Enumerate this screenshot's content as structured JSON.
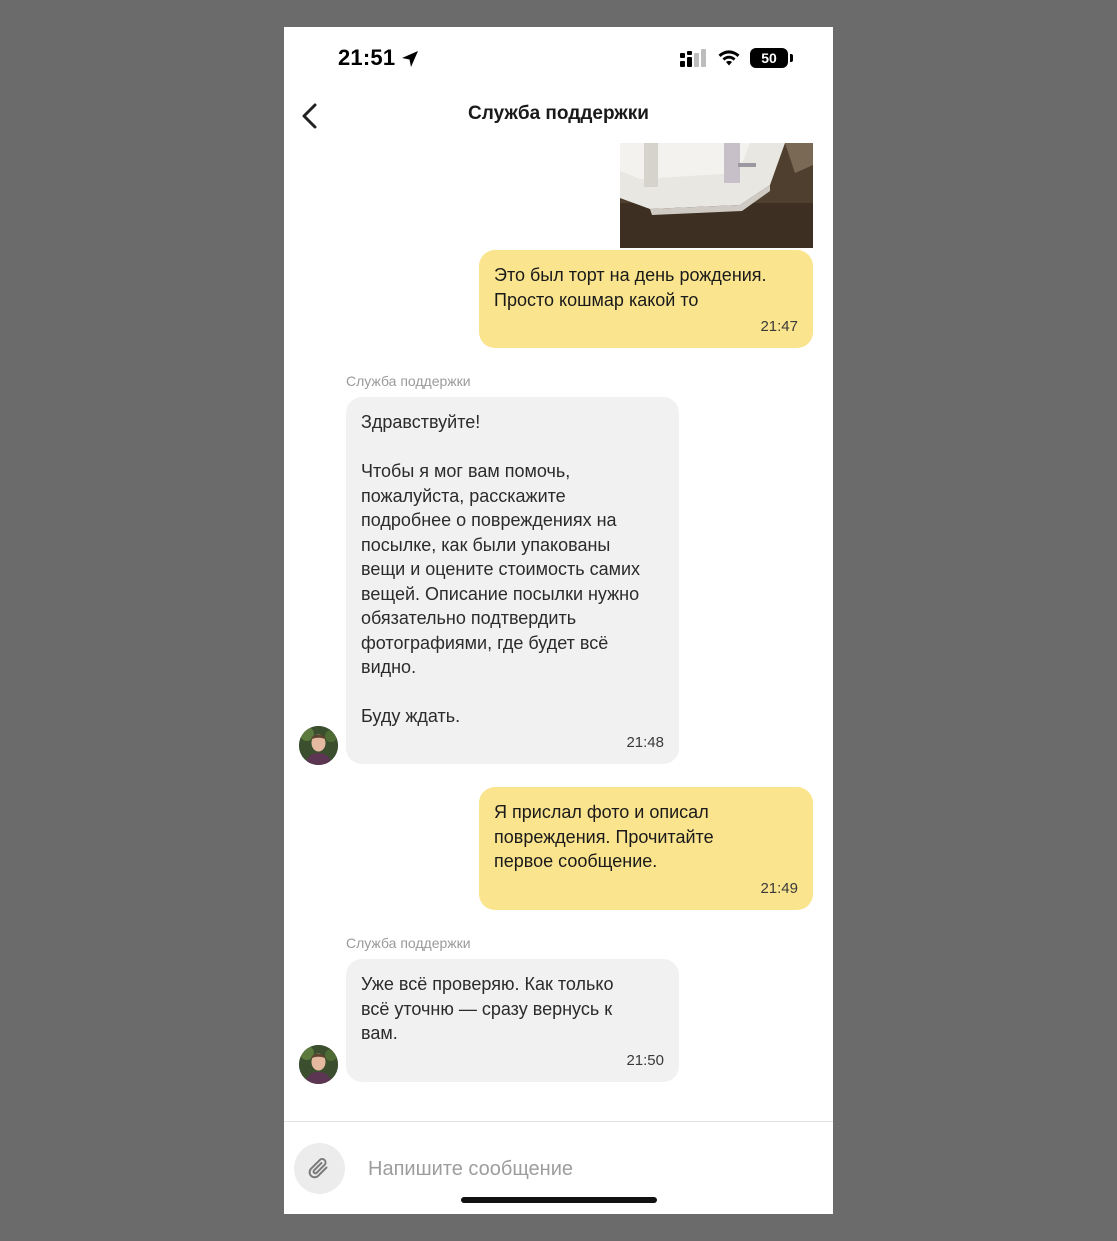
{
  "status_bar": {
    "time": "21:51",
    "battery": "50"
  },
  "header": {
    "title": "Служба поддержки"
  },
  "messages": [
    {
      "from": "me",
      "type": "image"
    },
    {
      "from": "me",
      "text": "Это был торт на день рождения.\nПросто кошмар какой то",
      "time": "21:47"
    },
    {
      "from": "support",
      "sender": "Служба поддержки",
      "text": "Здравствуйте!\n\nЧтобы я мог вам помочь,\nпожалуйста, расскажите\nподробнее о повреждениях на\nпосылке, как были упакованы\nвещи и оцените стоимость самих\nвещей. Описание посылки нужно\nобязательно подтвердить\nфотографиями, где будет всё\nвидно.\n\nБуду ждать.",
      "time": "21:48"
    },
    {
      "from": "me",
      "text": "Я прислал фото и описал\nповреждения. Прочитайте\nпервое сообщение.",
      "time": "21:49"
    },
    {
      "from": "support",
      "sender": "Служба поддержки",
      "text": "Уже всё проверяю. Как только\nвсё уточню — сразу вернусь к\nвам.",
      "time": "21:50"
    }
  ],
  "composer": {
    "placeholder": "Напишите сообщение"
  },
  "icons": {
    "back": "chevron-left-icon",
    "attach": "paperclip-icon",
    "location": "location-arrow-icon",
    "signal": "cellular-signal-icon",
    "wifi": "wifi-icon",
    "battery": "battery-icon"
  },
  "colors": {
    "outgoing_bubble": "#fae48e",
    "incoming_bubble": "#f1f1f1",
    "background": "#ffffff",
    "frame": "#6b6b6b"
  }
}
